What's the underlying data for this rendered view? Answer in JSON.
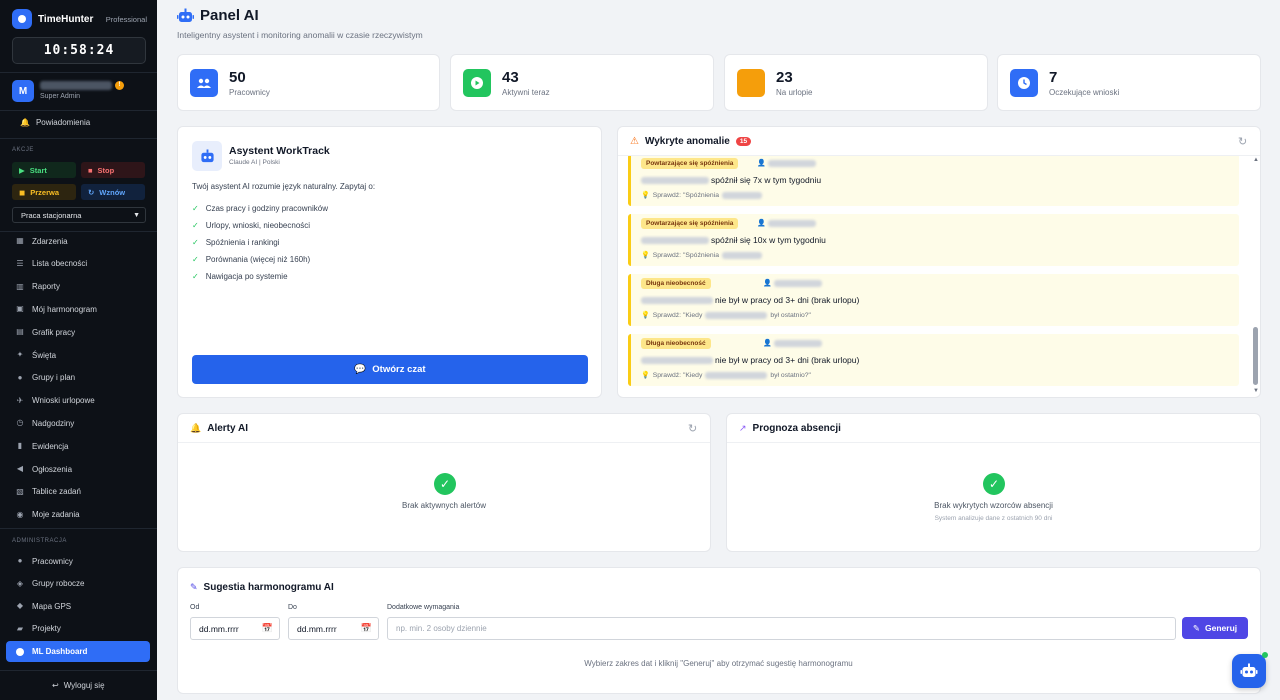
{
  "brand": {
    "name": "TimeHunter",
    "plan": "Professional"
  },
  "clock": "10:58:24",
  "user": {
    "initial": "M",
    "role": "Super Admin",
    "badge": "!"
  },
  "notifications": "Powiadomienia",
  "actions": {
    "section": "AKCJE",
    "start": "Start",
    "stop": "Stop",
    "break": "Przerwa",
    "resume": "Wznów",
    "work_mode": "Praca stacjonarna"
  },
  "nav": [
    {
      "label": "Zdarzenia",
      "icon": "grid-icon"
    },
    {
      "label": "Lista obecności",
      "icon": "list-icon"
    },
    {
      "label": "Raporty",
      "icon": "chart-icon"
    },
    {
      "label": "Mój harmonogram",
      "icon": "calendar-icon"
    },
    {
      "label": "Grafik pracy",
      "icon": "table-icon"
    },
    {
      "label": "Święta",
      "icon": "star-icon"
    },
    {
      "label": "Grupy i plan",
      "icon": "users-icon"
    },
    {
      "label": "Wnioski urlopowe",
      "icon": "plane-icon"
    },
    {
      "label": "Nadgodziny",
      "icon": "clock-icon"
    },
    {
      "label": "Ewidencja",
      "icon": "book-icon"
    },
    {
      "label": "Ogłoszenia",
      "icon": "megaphone-icon"
    },
    {
      "label": "Tablice zadań",
      "icon": "board-icon"
    },
    {
      "label": "Moje zadania",
      "icon": "check-icon"
    }
  ],
  "admin": {
    "section": "ADMINISTRACJA",
    "items": [
      {
        "label": "Pracownicy",
        "icon": "users-icon"
      },
      {
        "label": "Grupy robocze",
        "icon": "layers-icon"
      },
      {
        "label": "Mapa GPS",
        "icon": "map-icon"
      },
      {
        "label": "Projekty",
        "icon": "folder-icon"
      }
    ],
    "active": "ML Dashboard"
  },
  "logout": "Wyloguj się",
  "page": {
    "title": "Panel AI",
    "subtitle": "Inteligentny asystent i monitoring anomalii w czasie rzeczywistym"
  },
  "stats": [
    {
      "value": "50",
      "label": "Pracownicy",
      "color": "#2f6df6"
    },
    {
      "value": "43",
      "label": "Aktywni teraz",
      "color": "#22c55e"
    },
    {
      "value": "23",
      "label": "Na urlopie",
      "color": "#f59e0b"
    },
    {
      "value": "7",
      "label": "Oczekujące wnioski",
      "color": "#2f6df6"
    }
  ],
  "assistant": {
    "title": "Asystent WorkTrack",
    "subtitle": "Claude AI | Polski",
    "intro": "Twój asystent AI rozumie język naturalny. Zapytaj o:",
    "features": [
      "Czas pracy i godziny pracowników",
      "Urlopy, wnioski, nieobecności",
      "Spóźnienia i rankingi",
      "Porównania (więcej niż 160h)",
      "Nawigacja po systemie"
    ],
    "button": "Otwórz czat"
  },
  "anomalies": {
    "title": "Wykryte anomalie",
    "count": "15",
    "items": [
      {
        "tag": "Powtarzające się spóźnienia",
        "message": "spóźnił się 7x w tym tygodniu",
        "hint_prefix": "Sprawdź: \"Spóźnienia",
        "hint_suffix": ""
      },
      {
        "tag": "Powtarzające się spóźnienia",
        "message": "spóźnił się 10x w tym tygodniu",
        "hint_prefix": "Sprawdź: \"Spóźnienia",
        "hint_suffix": ""
      },
      {
        "tag": "Długa nieobecność",
        "message": "nie był w pracy od 3+ dni (brak urlopu)",
        "hint_prefix": "Sprawdź: \"Kiedy",
        "hint_suffix": "był ostatnio?\""
      },
      {
        "tag": "Długa nieobecność",
        "message": "nie był w pracy od 3+ dni (brak urlopu)",
        "hint_prefix": "Sprawdź: \"Kiedy",
        "hint_suffix": "był ostatnio?\""
      }
    ]
  },
  "alerts": {
    "title": "Alerty AI",
    "empty": "Brak aktywnych alertów"
  },
  "forecast": {
    "title": "Prognoza absencji",
    "empty": "Brak wykrytych wzorców absencji",
    "note": "System analizuje dane z ostatnich 90 dni"
  },
  "schedule": {
    "title": "Sugestia harmonogramu AI",
    "from_label": "Od",
    "to_label": "Do",
    "req_label": "Dodatkowe wymagania",
    "date_value": "dd.mm.rrrr",
    "req_placeholder": "np. min. 2 osoby dziennie",
    "button": "Generuj",
    "hint": "Wybierz zakres dat i kliknij \"Generuj\" aby otrzymać sugestię harmonogramu"
  }
}
